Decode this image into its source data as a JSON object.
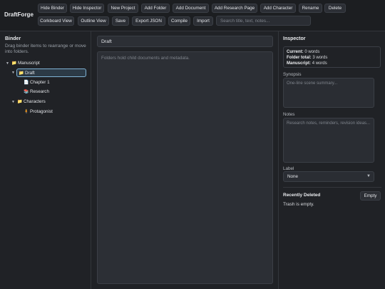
{
  "app": {
    "title": "DraftForge"
  },
  "toolbar": {
    "hide_binder": "Hide Binder",
    "hide_inspector": "Hide Inspector",
    "new_project": "New Project",
    "add_folder": "Add Folder",
    "add_document": "Add Document",
    "add_research_page": "Add Research Page",
    "add_character": "Add Character",
    "rename": "Rename",
    "delete": "Delete",
    "corkboard_view": "Corkboard View",
    "outline_view": "Outline View",
    "save": "Save",
    "export_json": "Export JSON",
    "compile": "Compile",
    "import": "Import",
    "search_placeholder": "Search title, text, notes..."
  },
  "binder": {
    "title": "Binder",
    "hint": "Drag binder items to rearrange or move into folders.",
    "items": [
      {
        "label": "Manuscript",
        "icon": "folder-icon",
        "glyph": "📁",
        "caret": "▼"
      },
      {
        "label": "Draft",
        "icon": "folder-icon",
        "glyph": "📁",
        "caret": "▼",
        "selected": true
      },
      {
        "label": "Chapter 1",
        "icon": "document-icon",
        "glyph": "📄"
      },
      {
        "label": "Research",
        "icon": "research-icon",
        "glyph": "📚"
      },
      {
        "label": "Characters",
        "icon": "folder-icon",
        "glyph": "📁",
        "caret": "▼"
      },
      {
        "label": "Protagonist",
        "icon": "character-icon",
        "glyph": "🧍"
      }
    ]
  },
  "editor": {
    "title_value": "Draft",
    "body_placeholder": "Folders hold child documents and metadata."
  },
  "inspector": {
    "title": "Inspector",
    "stats": {
      "current_label": "Current:",
      "current_value": "0 words",
      "folder_label": "Folder total:",
      "folder_value": "3 words",
      "manuscript_label": "Manuscript:",
      "manuscript_value": "4 words"
    },
    "synopsis_label": "Synopsis",
    "synopsis_placeholder": "One-line scene summary...",
    "notes_label": "Notes",
    "notes_placeholder": "Research notes, reminders, revision ideas...",
    "label_label": "Label",
    "label_value": "None",
    "recently_deleted_title": "Recently Deleted",
    "empty_button": "Empty",
    "trash_status": "Trash is empty."
  },
  "colors": {
    "background": "#202226",
    "panel": "#2c2f35",
    "selected_border": "#7fb3d5"
  }
}
